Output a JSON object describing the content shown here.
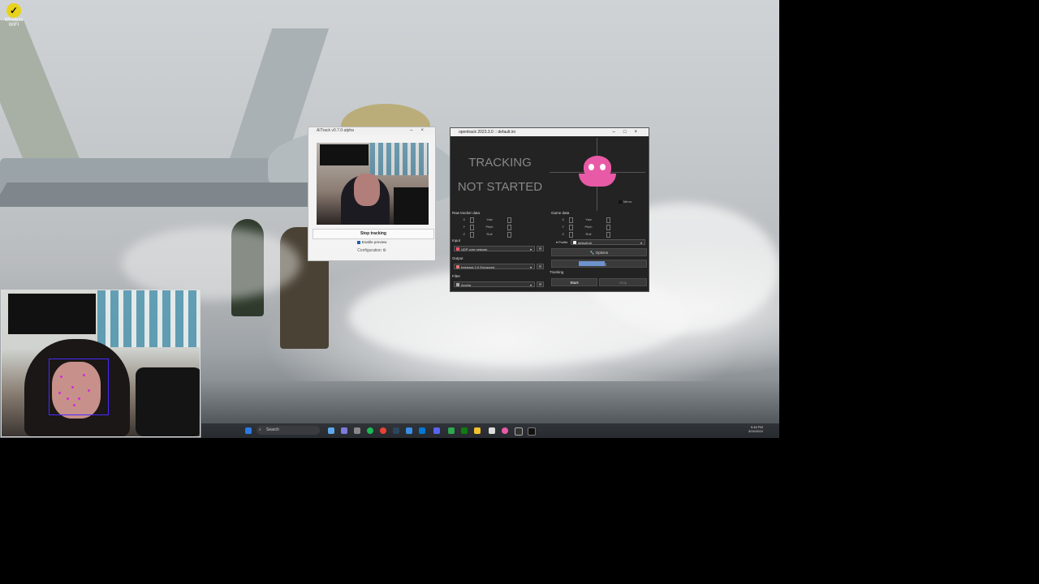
{
  "desktop": {
    "icon_label": "Wireless WIFI"
  },
  "aitrack": {
    "title": "AITrack v0.7.0-alpha",
    "stop_button": "Stop tracking",
    "enable_preview": "Enable preview",
    "configuration": "Configuration"
  },
  "opentrack": {
    "title": "opentrack 2023.3.0 :: default.ini",
    "status_line1": "TRACKING",
    "status_line2": "NOT STARTED",
    "mirror_label": "Mirror",
    "raw_tracker_title": "Raw tracker data",
    "game_data_title": "Game data",
    "axes": [
      "X",
      "Y",
      "Z"
    ],
    "rot_axes": [
      "Yaw",
      "Pitch",
      "Roll"
    ],
    "input_label": "Input",
    "input_value": "UDP over network",
    "output_label": "Output",
    "output_value": "freetrack 2.0 Enhanced",
    "filter_label": "Filter",
    "filter_value": "Accela",
    "profile_label": "Profile",
    "profile_value": "default.ini",
    "options_button": "Options",
    "mapping_button": "Mapping",
    "tracking_label": "Tracking",
    "start_button": "Start",
    "stop_button": "Stop"
  },
  "taskbar": {
    "search_placeholder": "Search",
    "time": "9:46 PM",
    "date": "3/24/2024"
  },
  "colors": {
    "accent": "#1a5fb4",
    "octopus": "#e95aa6",
    "landmark": "#d22bd8"
  }
}
